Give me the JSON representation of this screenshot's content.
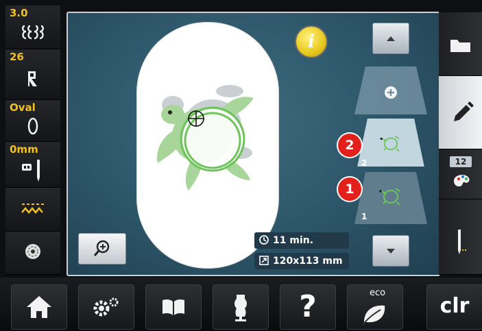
{
  "left_panel": {
    "stitch_width": "3.0",
    "stitch_length": "26",
    "hoop": "Oval",
    "needle_position": "0mm"
  },
  "workspace": {
    "info_label": "i",
    "time_value": "11 min.",
    "size_value": "120x113 mm",
    "layers": [
      {
        "badge": "2",
        "number": "2"
      },
      {
        "badge": "1",
        "number": "1"
      }
    ]
  },
  "right_panel": {
    "color_count": "12"
  },
  "bottom_bar": {
    "help_label": "?",
    "eco_label": "eco",
    "clear_label": "clr"
  },
  "colors": {
    "accent_yellow": "#f3c21a",
    "badge_red": "#e2211c",
    "workspace_blue": "#2c5568",
    "stitch_green": "#6ec45a"
  },
  "icons": [
    "stitch-width-icon",
    "stitch-length-icon",
    "hoop-icon",
    "needle-position-icon",
    "thread-icon",
    "bobbin-icon",
    "zoom-icon",
    "clock-icon",
    "size-icon",
    "scroll-up-icon",
    "scroll-down-icon",
    "add-layer-icon",
    "folder-icon",
    "pencil-icon",
    "palette-icon",
    "needle-down-icon",
    "home-icon",
    "settings-icon",
    "manual-icon",
    "tutorial-icon",
    "help-icon",
    "eco-leaf-icon"
  ]
}
